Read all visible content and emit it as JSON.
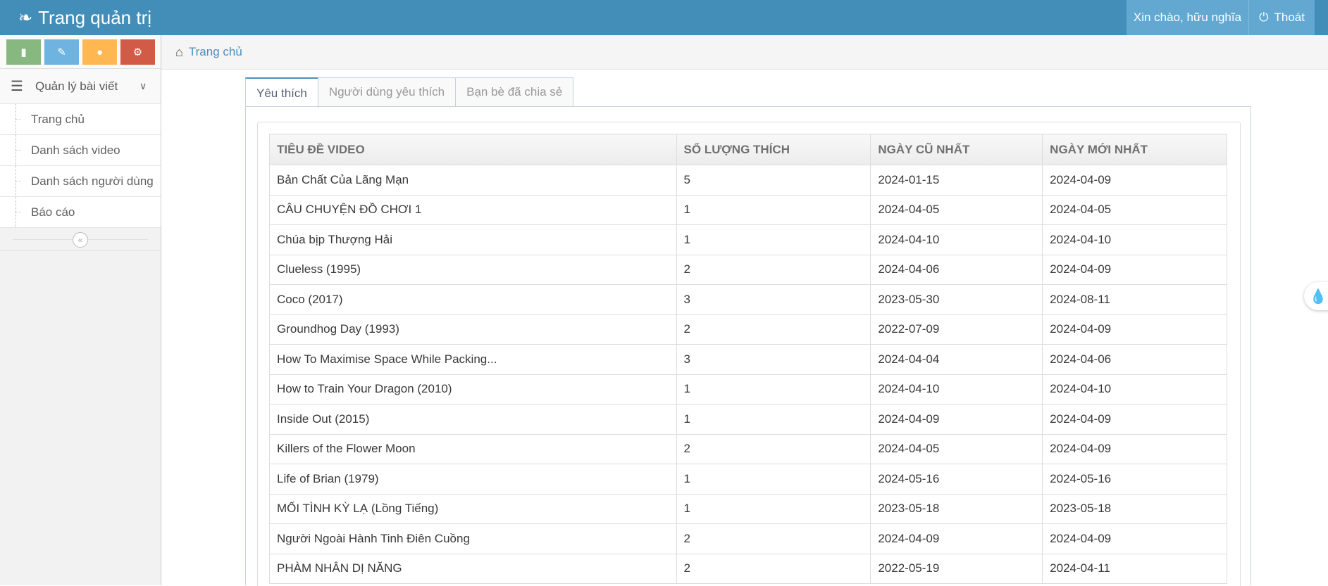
{
  "navbar": {
    "brand": "Trang quản trị",
    "greeting": "Xin chào, hữu nghĩa",
    "logout": "Thoát"
  },
  "sidebar": {
    "shortcuts": [
      "signal-icon",
      "pencil-icon",
      "users-icon",
      "cogs-icon"
    ],
    "menu_title": "Quản lý bài viết",
    "items": [
      {
        "label": "Trang chủ"
      },
      {
        "label": "Danh sách video"
      },
      {
        "label": "Danh sách người dùng"
      },
      {
        "label": "Báo cáo"
      }
    ]
  },
  "breadcrumb": {
    "home": "Trang chủ"
  },
  "tabs": [
    {
      "label": "Yêu thích",
      "active": true
    },
    {
      "label": "Người dùng yêu thích",
      "active": false
    },
    {
      "label": "Bạn bè đã chia sẻ",
      "active": false
    }
  ],
  "table": {
    "headers": [
      "TIÊU ĐỀ VIDEO",
      "SỐ LƯỢNG THÍCH",
      "NGÀY CŨ NHẤT",
      "NGÀY MỚI NHẤT"
    ],
    "rows": [
      [
        "Bản Chất Của Lãng Mạn",
        "5",
        "2024-01-15",
        "2024-04-09"
      ],
      [
        "CÂU CHUYỆN ĐỒ CHƠI 1",
        "1",
        "2024-04-05",
        "2024-04-05"
      ],
      [
        "Chúa bịp Thượng Hải",
        "1",
        "2024-04-10",
        "2024-04-10"
      ],
      [
        "Clueless (1995)",
        "2",
        "2024-04-06",
        "2024-04-09"
      ],
      [
        "Coco (2017)",
        "3",
        "2023-05-30",
        "2024-08-11"
      ],
      [
        "Groundhog Day (1993)",
        "2",
        "2022-07-09",
        "2024-04-09"
      ],
      [
        "How To Maximise Space While Packing...",
        "3",
        "2024-04-04",
        "2024-04-06"
      ],
      [
        "How to Train Your Dragon (2010)",
        "1",
        "2024-04-10",
        "2024-04-10"
      ],
      [
        "Inside Out (2015)",
        "1",
        "2024-04-09",
        "2024-04-09"
      ],
      [
        "Killers of the Flower Moon",
        "2",
        "2024-04-05",
        "2024-04-09"
      ],
      [
        "Life of Brian (1979)",
        "1",
        "2024-05-16",
        "2024-05-16"
      ],
      [
        "MỐI TÌNH KỲ LẠ (Lồng Tiếng)",
        "1",
        "2023-05-18",
        "2023-05-18"
      ],
      [
        "Người Ngoài Hành Tinh Điên Cuồng",
        "2",
        "2024-04-09",
        "2024-04-09"
      ],
      [
        "PHÀM NHÂN DỊ NĂNG",
        "2",
        "2022-05-19",
        "2024-04-11"
      ]
    ]
  },
  "colors": {
    "navbar": "#438eb9",
    "accent": "#4c8fbd"
  }
}
